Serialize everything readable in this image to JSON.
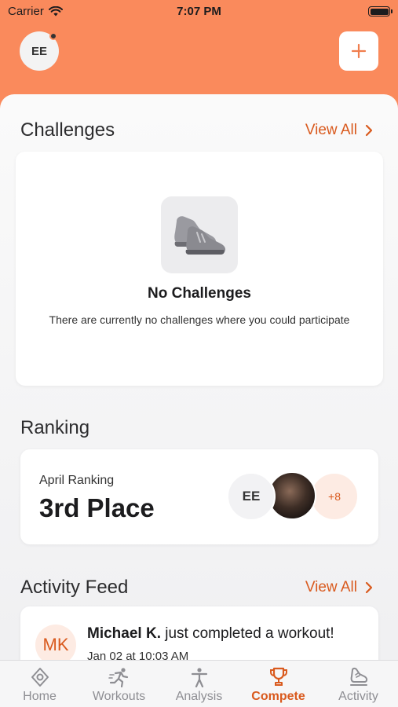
{
  "status_bar": {
    "carrier": "Carrier",
    "time": "7:07 PM"
  },
  "header": {
    "avatar_initials": "EE"
  },
  "challenges": {
    "title": "Challenges",
    "view_all": "View All",
    "empty_title": "No Challenges",
    "empty_message": "There are currently no challenges where you could participate"
  },
  "ranking": {
    "title": "Ranking",
    "period_label": "April Ranking",
    "place": "3rd Place",
    "participants": {
      "first_initials": "EE",
      "more_count": "+8"
    }
  },
  "activity_feed": {
    "title": "Activity Feed",
    "view_all": "View All",
    "items": [
      {
        "initials": "MK",
        "user": "Michael K.",
        "action": " just completed a workout!",
        "time": "Jan 02 at 10:03 AM"
      }
    ]
  },
  "tabbar": {
    "tabs": [
      {
        "label": "Home",
        "icon": "home-icon"
      },
      {
        "label": "Workouts",
        "icon": "workouts-icon"
      },
      {
        "label": "Analysis",
        "icon": "analysis-icon"
      },
      {
        "label": "Compete",
        "icon": "trophy-icon",
        "active": true
      },
      {
        "label": "Activity",
        "icon": "activity-icon"
      }
    ]
  },
  "colors": {
    "accent": "#fa8a5c",
    "accent_text": "#d95a1e",
    "background": "#f4f4f5"
  }
}
